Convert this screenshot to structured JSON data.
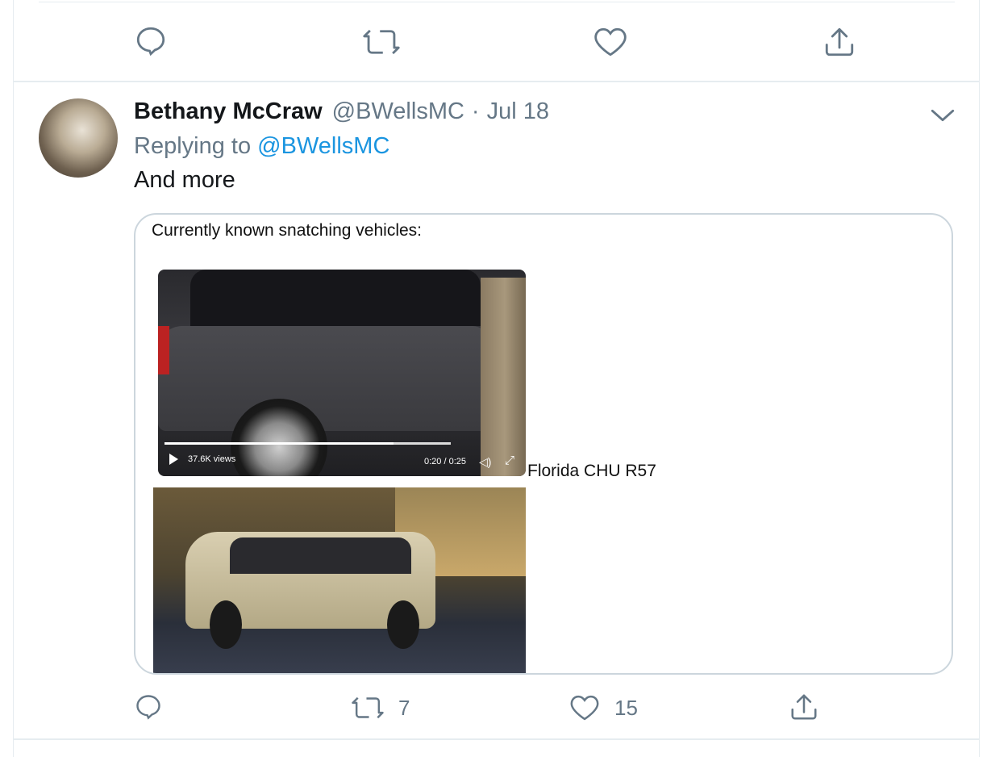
{
  "tweet": {
    "author": {
      "name": "Bethany McCraw",
      "handle": "@BWellsMC"
    },
    "separator": "·",
    "date": "Jul 18",
    "replying_prefix": "Replying to",
    "replying_to": "@BWellsMC",
    "text": "And more",
    "media": {
      "caption": "Currently known snatching vehicles:",
      "label": "Florida CHU R57",
      "video": {
        "views": "37.6K views",
        "time": "0:20 / 0:25",
        "progress": 0.8
      }
    },
    "actions": {
      "retweets": "7",
      "likes": "15"
    }
  },
  "colors": {
    "muted": "#657786",
    "link": "#1b95e0",
    "text": "#14171a",
    "border": "#e6ecf0"
  }
}
